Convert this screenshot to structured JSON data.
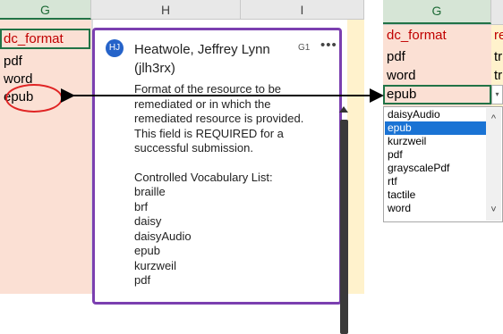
{
  "left": {
    "col_headers": [
      "G",
      "H",
      "I"
    ],
    "cells": [
      "dc_format",
      "pdf",
      "word",
      "epub"
    ]
  },
  "comment": {
    "avatar_initials": "HJ",
    "author_line1": "Heatwole, Jeffrey Lynn",
    "author_line2": "(jlh3rx)",
    "cell_ref": "G1",
    "more_label": "•••",
    "lines": [
      "Format of the resource to be",
      "remediated or in which the",
      "remediated resource is provided.",
      "This field is REQUIRED for a",
      "successful submission."
    ],
    "vocab_title": "Controlled Vocabulary List:",
    "vocab": [
      "braille",
      "brf",
      "daisy",
      "daisyAudio",
      "epub",
      "kurzweil",
      "pdf"
    ]
  },
  "right": {
    "col_header": "G",
    "cells": [
      "dc_format",
      "pdf",
      "word",
      "epub"
    ],
    "neighbor_cells": [
      "re",
      "tr",
      "tr"
    ],
    "dropdown_options": [
      "daisyAudio",
      "epub",
      "kurzweil",
      "pdf",
      "grayscalePdf",
      "rtf",
      "tactile",
      "word"
    ],
    "selected_option": "epub",
    "chevron_up": "^",
    "chevron_down": "˅",
    "dropdown_button": "▾"
  },
  "colors": {
    "cell_bg_pink": "#fbe0d4",
    "cell_bg_yellow": "#fff2cc",
    "accent_green": "#217346",
    "comment_border": "#7b3fb0",
    "highlight_red": "#e02424",
    "selection_blue": "#1a73d4"
  }
}
